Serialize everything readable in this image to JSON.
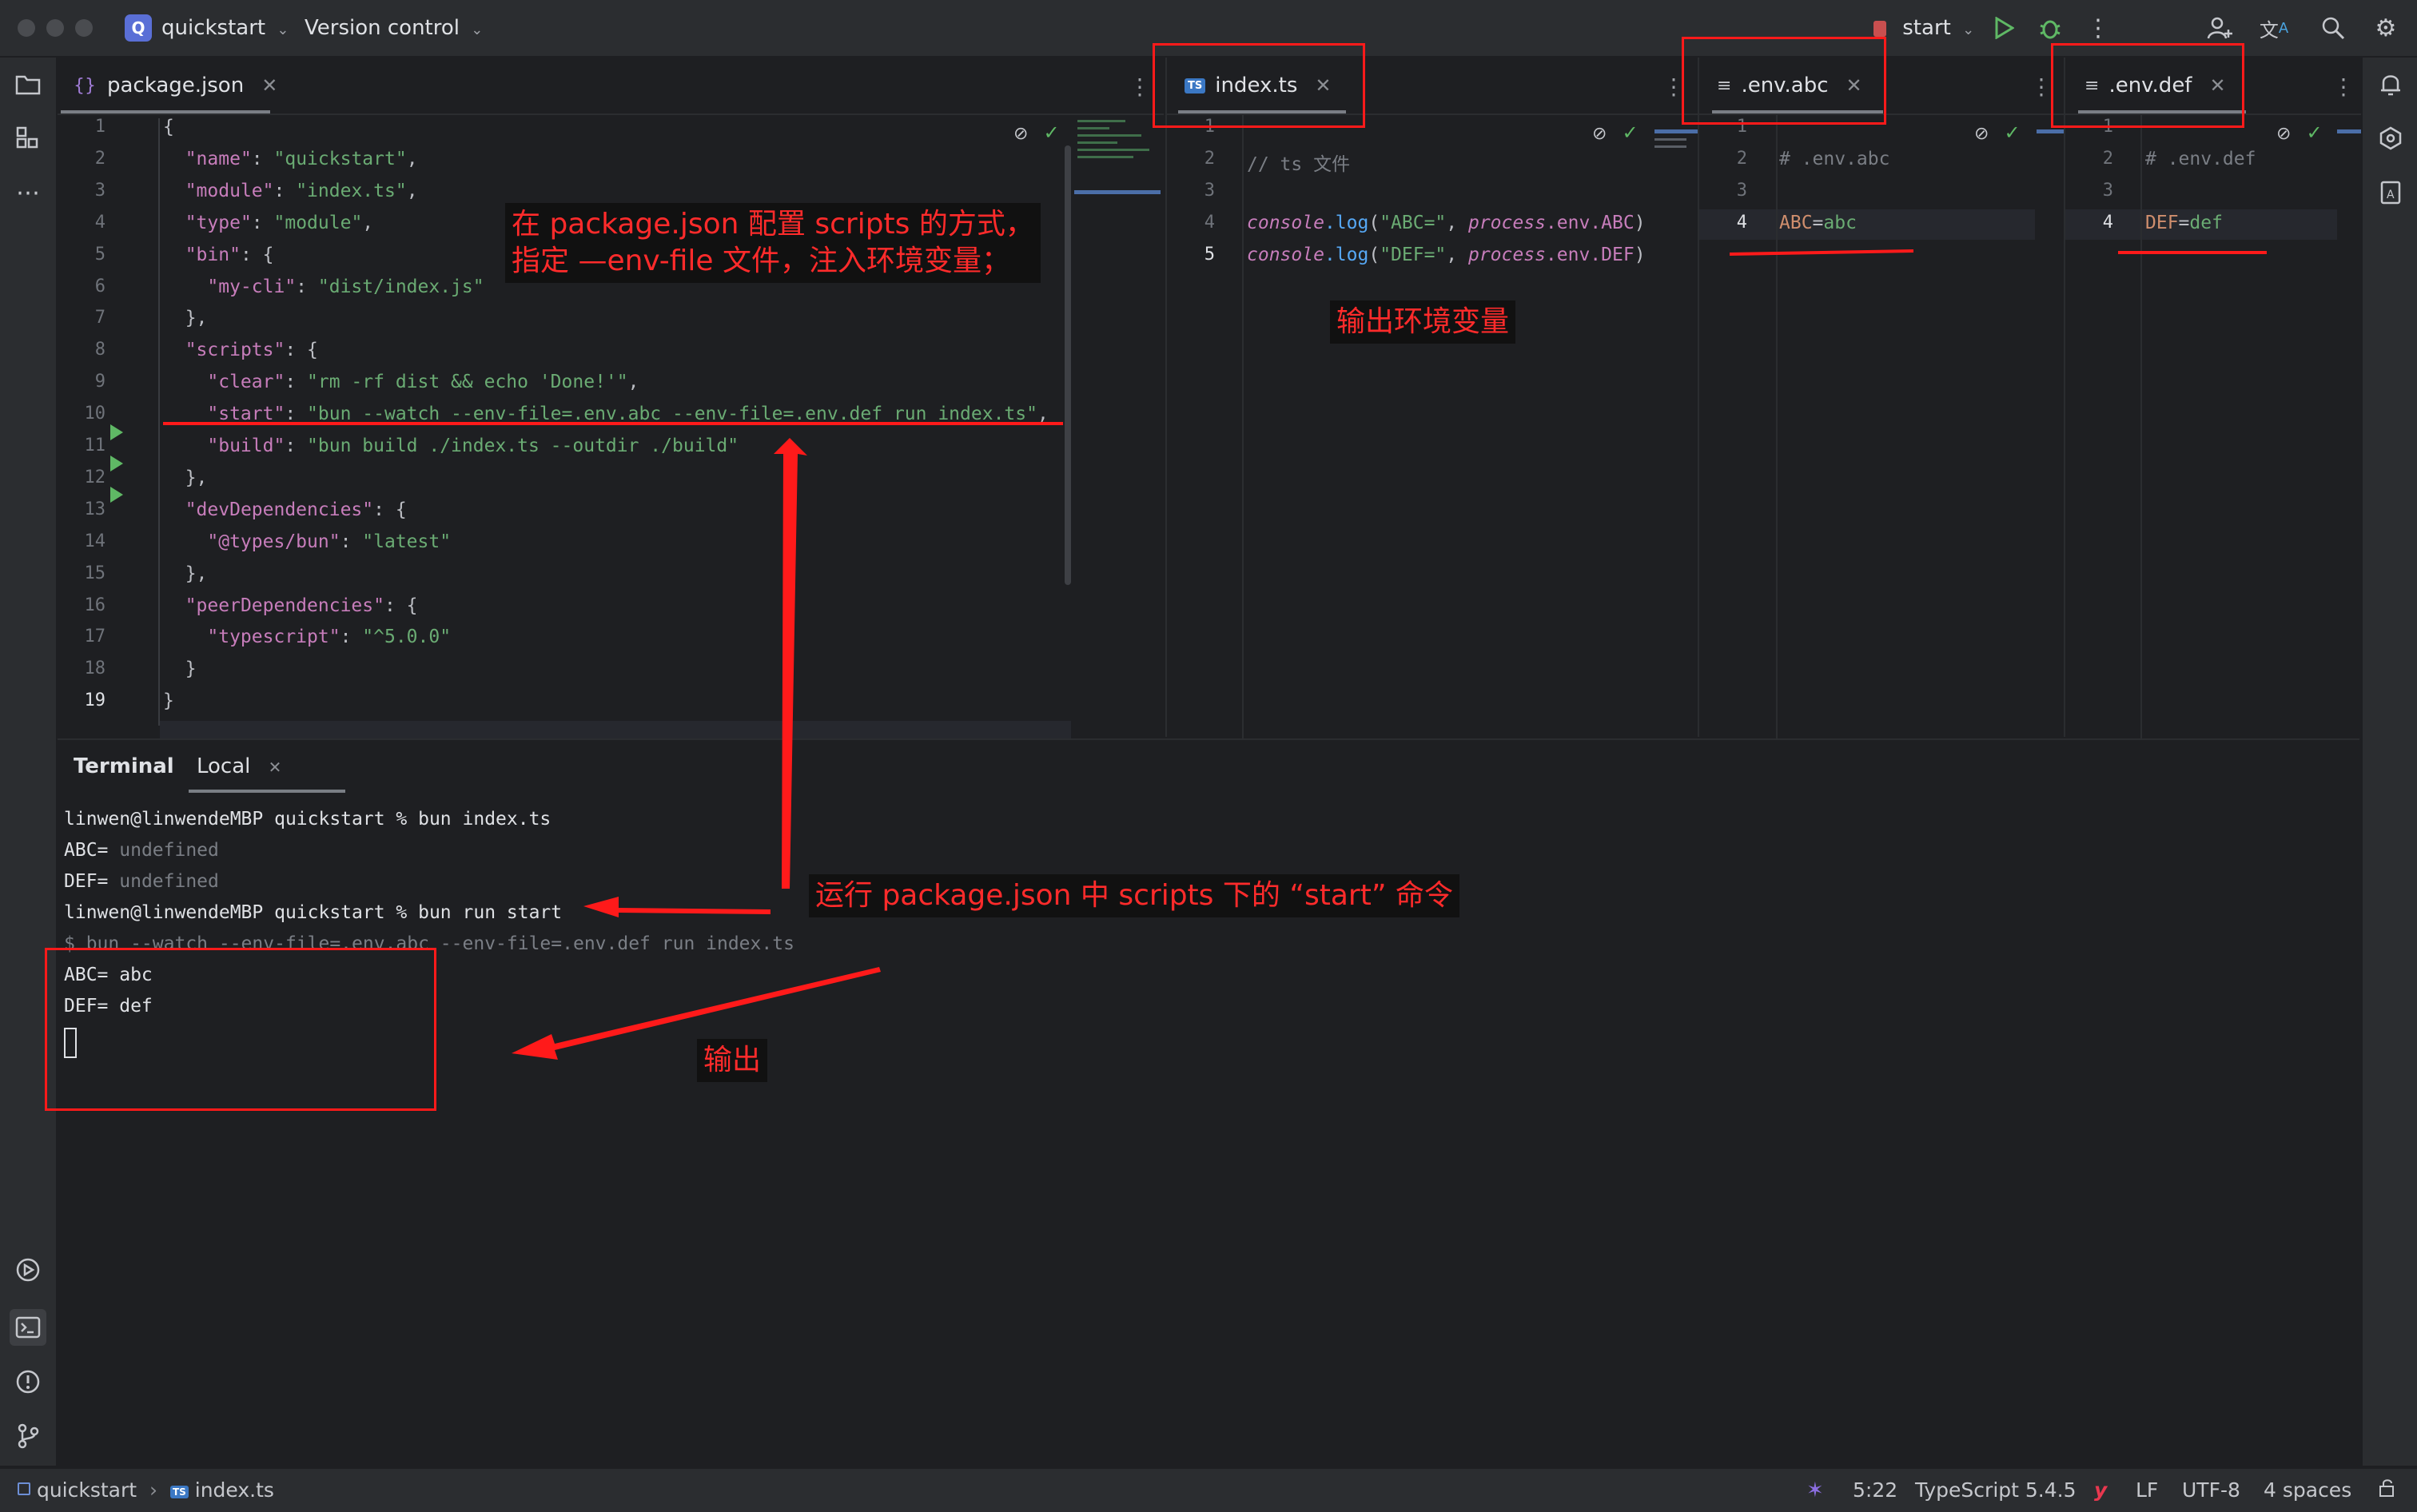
{
  "titlebar": {
    "project_badge": "Q",
    "project_name": "quickstart",
    "vcs_label": "Version control",
    "run_config": "start",
    "icons": [
      "chevron-down-icon",
      "run-icon",
      "debug-icon",
      "more-icon",
      "add-user-icon",
      "translate-icon",
      "search-icon",
      "settings-icon"
    ]
  },
  "editors": {
    "package_json": {
      "tab_label": "package.json",
      "lines": [
        {
          "n": "1",
          "text": "{"
        },
        {
          "n": "2",
          "text": "  \"name\": \"quickstart\","
        },
        {
          "n": "3",
          "text": "  \"module\": \"index.ts\","
        },
        {
          "n": "4",
          "text": "  \"type\": \"module\","
        },
        {
          "n": "5",
          "text": "  \"bin\": {"
        },
        {
          "n": "6",
          "text": "    \"my-cli\": \"dist/index.js\""
        },
        {
          "n": "7",
          "text": "  },"
        },
        {
          "n": "8",
          "text": "  \"scripts\": {"
        },
        {
          "n": "9",
          "text": "    \"clear\": \"rm -rf dist && echo 'Done!'\","
        },
        {
          "n": "10",
          "text": "    \"start\": \"bun --watch --env-file=.env.abc --env-file=.env.def run index.ts\","
        },
        {
          "n": "11",
          "text": "    \"build\": \"bun build ./index.ts --outdir ./build\""
        },
        {
          "n": "12",
          "text": "  },"
        },
        {
          "n": "13",
          "text": "  \"devDependencies\": {"
        },
        {
          "n": "14",
          "text": "    \"@types/bun\": \"latest\""
        },
        {
          "n": "15",
          "text": "  },"
        },
        {
          "n": "16",
          "text": "  \"peerDependencies\": {"
        },
        {
          "n": "17",
          "text": "    \"typescript\": \"^5.0.0\""
        },
        {
          "n": "18",
          "text": "  }"
        },
        {
          "n": "19",
          "text": "}"
        }
      ]
    },
    "index_ts": {
      "tab_label": "index.ts",
      "tab_badge": "TS",
      "lines": [
        {
          "n": "1",
          "text": ""
        },
        {
          "n": "2",
          "text": "// ts 文件"
        },
        {
          "n": "3",
          "text": ""
        },
        {
          "n": "4",
          "text": "console.log(\"ABC=\", process.env.ABC)"
        },
        {
          "n": "5",
          "text": "console.log(\"DEF=\", process.env.DEF)"
        }
      ]
    },
    "env_abc": {
      "tab_label": ".env.abc",
      "lines": [
        {
          "n": "1",
          "text": ""
        },
        {
          "n": "2",
          "text": "# .env.abc"
        },
        {
          "n": "3",
          "text": ""
        },
        {
          "n": "4",
          "text": "ABC=abc"
        }
      ]
    },
    "env_def": {
      "tab_label": ".env.def",
      "lines": [
        {
          "n": "1",
          "text": ""
        },
        {
          "n": "2",
          "text": "# .env.def"
        },
        {
          "n": "3",
          "text": ""
        },
        {
          "n": "4",
          "text": "DEF=def"
        }
      ]
    }
  },
  "terminal": {
    "title": "Terminal",
    "tab_label": "Local",
    "lines": [
      "linwen@linwendeMBP quickstart % bun index.ts",
      "ABC= undefined",
      "DEF= undefined",
      "linwen@linwendeMBP quickstart % bun run start",
      "$ bun --watch --env-file=.env.abc --env-file=.env.def run index.ts",
      "ABC= abc",
      "DEF= def"
    ]
  },
  "annotations": {
    "note_scripts": "在 package.json 配置 scripts 的方式，\n指定 —env-file 文件，注入环境变量；",
    "note_output_env": "输出环境变量",
    "note_run": "运行 package.json 中 scripts 下的 “start” 命令",
    "note_output": "输出",
    "color": "#ff1a1a"
  },
  "statusbar": {
    "project": "quickstart",
    "file": "index.ts",
    "position": "5:22",
    "language": "TypeScript 5.4.5",
    "line_ending": "LF",
    "encoding": "UTF-8",
    "indent": "4 spaces"
  },
  "colors": {
    "background": "#1e1f22",
    "panel": "#2b2d30",
    "string": "#6aab73",
    "keyword": "#c77dbb",
    "function": "#56a8f5",
    "accent": "#5a6fd6"
  }
}
